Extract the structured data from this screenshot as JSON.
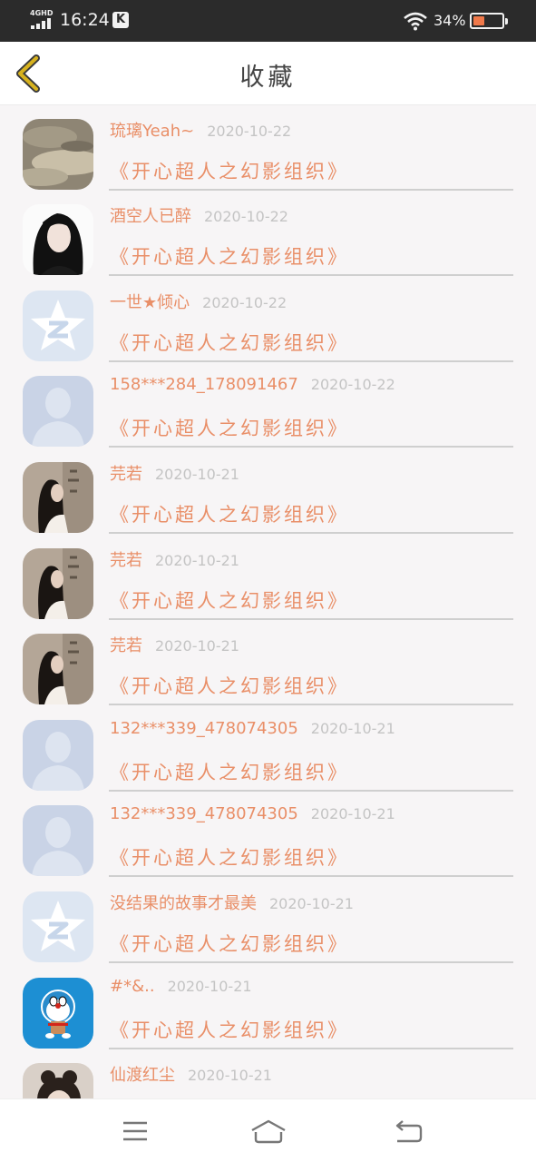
{
  "status_bar": {
    "network": "4GHD",
    "time": "16:24",
    "notification_icon": "K",
    "battery_percent": "34%",
    "battery_level": 0.34
  },
  "header": {
    "back_icon": "chevron-left-icon",
    "title": "收藏"
  },
  "colors": {
    "accent": "#e98f68",
    "meta_gray": "#c4c4c4",
    "back_chevron": "#c9a91a"
  },
  "favorites": [
    {
      "name": "",
      "date": "",
      "title": "《开心超人之幻影组织》",
      "avatar": "photo-girl-cropped"
    },
    {
      "name": "琉璃Yeah~",
      "date": "2020-10-22",
      "title": "《开心超人之幻影组织》",
      "avatar": "photo-clouds"
    },
    {
      "name": "酒空人已醉",
      "date": "2020-10-22",
      "title": "《开心超人之幻影组织》",
      "avatar": "photo-girl-black-hair"
    },
    {
      "name": "一世★倾心",
      "date": "2020-10-22",
      "title": "《开心超人之幻影组织》",
      "avatar": "qq-star-icon"
    },
    {
      "name": "158***284_178091467",
      "date": "2020-10-22",
      "title": "《开心超人之幻影组织》",
      "avatar": "default-user-icon"
    },
    {
      "name": "芫若",
      "date": "2020-10-21",
      "title": "《开心超人之幻影组织》",
      "avatar": "photo-girl-profile"
    },
    {
      "name": "芫若",
      "date": "2020-10-21",
      "title": "《开心超人之幻影组织》",
      "avatar": "photo-girl-profile"
    },
    {
      "name": "芫若",
      "date": "2020-10-21",
      "title": "《开心超人之幻影组织》",
      "avatar": "photo-girl-profile"
    },
    {
      "name": "132***339_478074305",
      "date": "2020-10-21",
      "title": "《开心超人之幻影组织》",
      "avatar": "default-user-icon"
    },
    {
      "name": "132***339_478074305",
      "date": "2020-10-21",
      "title": "《开心超人之幻影组织》",
      "avatar": "default-user-icon"
    },
    {
      "name": "没结果的故事才最美",
      "date": "2020-10-21",
      "title": "《开心超人之幻影组织》",
      "avatar": "qq-star-icon"
    },
    {
      "name": "#*&..",
      "date": "2020-10-21",
      "title": "《开心超人之幻影组织》",
      "avatar": "doraemon-icon"
    },
    {
      "name": "仙渡红尘",
      "date": "2020-10-21",
      "title": "",
      "avatar": "photo-girl-bun"
    }
  ],
  "nav_bar": {
    "menu_icon": "menu-icon",
    "home_icon": "home-icon",
    "back_icon": "back-arrow-icon"
  }
}
